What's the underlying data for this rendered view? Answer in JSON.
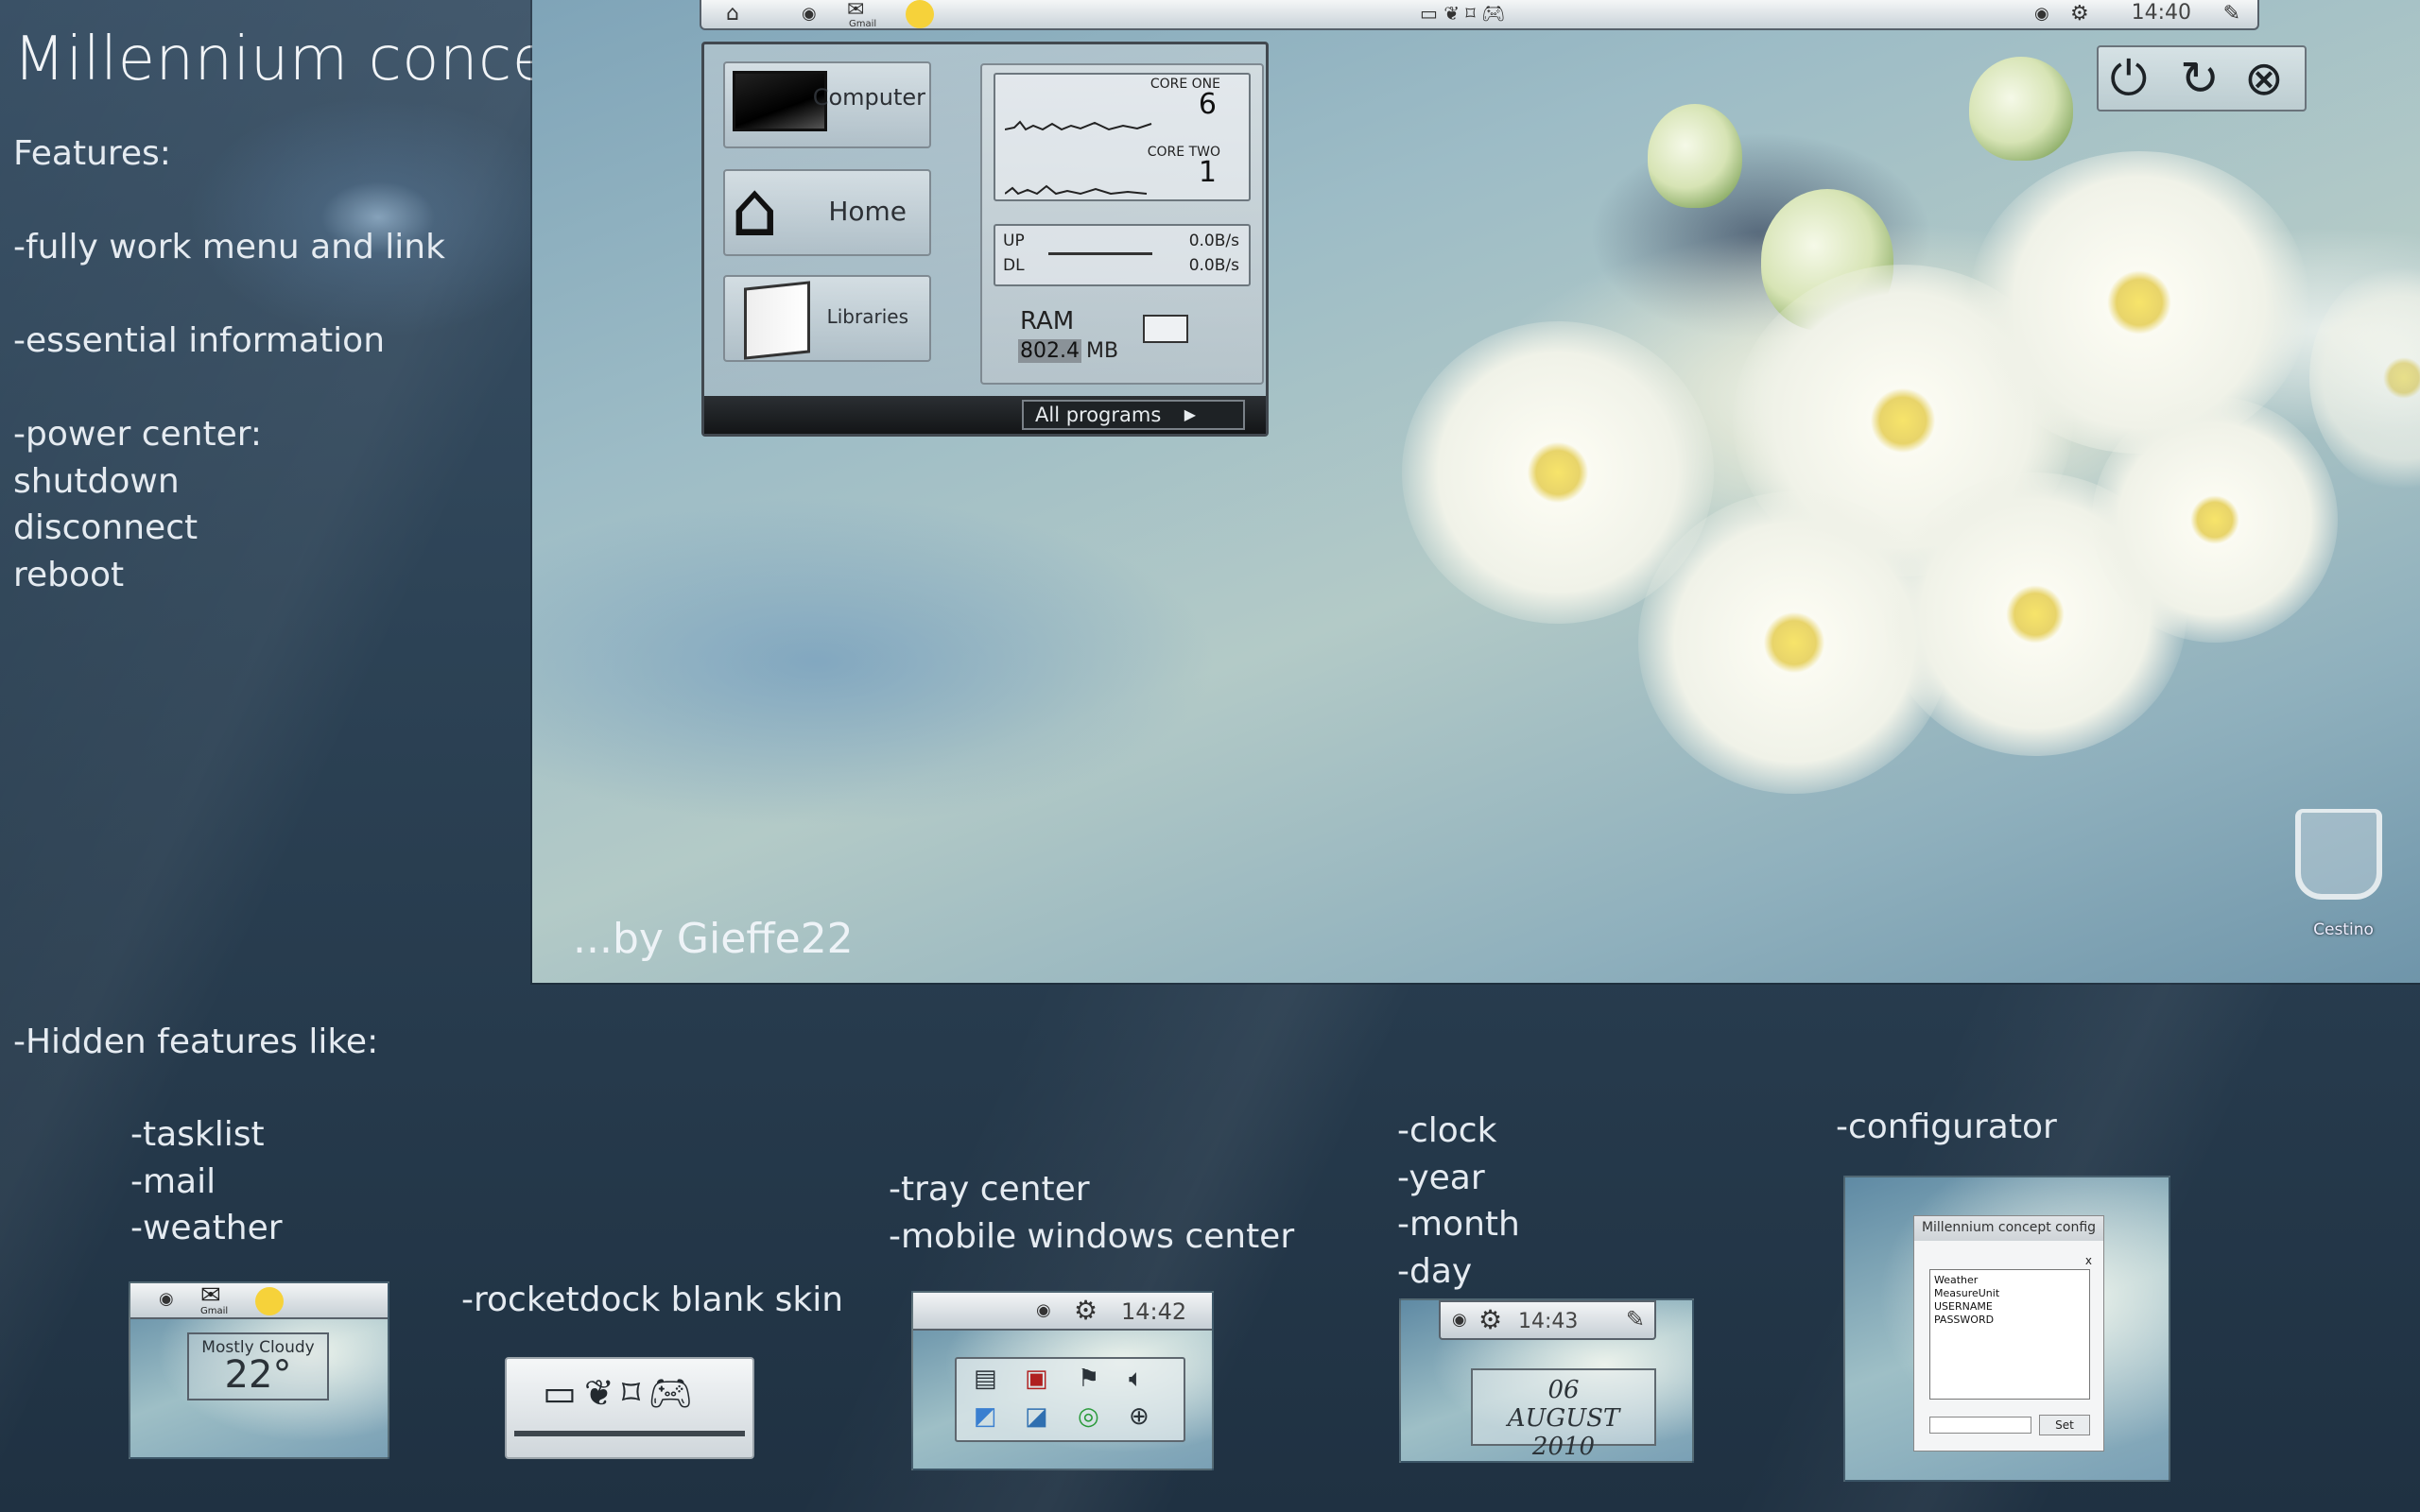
{
  "header": {
    "title": "Millennium concept",
    "features": [
      "Features:",
      "",
      "-fully work menu and link",
      "",
      "-essential information",
      "",
      "-power center:",
      "shutdown",
      "disconnect",
      "reboot"
    ]
  },
  "credit": "...by Gieffe22",
  "hidden": {
    "title": "-Hidden features like:",
    "group1": [
      "-tasklist",
      "-mail",
      "-weather"
    ],
    "group2": "-rocketdock blank skin",
    "group3": [
      "-tray center",
      "-mobile windows center"
    ],
    "group4": [
      "-clock",
      "-year",
      "-month",
      "-day"
    ],
    "group5": "-configurator"
  },
  "desktop": {
    "topbar": {
      "mail_label": "Gmail",
      "time": "14:40"
    },
    "menu": {
      "tiles": [
        "Computer",
        "Home",
        "Libraries"
      ],
      "core_one_label": "CORE ONE",
      "core_one_value": "6",
      "core_two_label": "CORE TWO",
      "core_two_value": "1",
      "up_label": "UP",
      "dl_label": "DL",
      "up_value": "0.0B/s",
      "dl_value": "0.0B/s",
      "ram_label": "RAM",
      "ram_value": "802.4",
      "ram_unit": "MB",
      "all_programs": "All programs"
    },
    "trash_label": "Cestino"
  },
  "thumbs": {
    "weather": {
      "mail_label": "Gmail",
      "condition": "Mostly Cloudy",
      "temp": "22°"
    },
    "tray": {
      "time": "14:42"
    },
    "clock": {
      "time": "14:43",
      "day": "06",
      "month_year": "AUGUST 2010"
    },
    "config": {
      "title": "Millennium concept config",
      "close": "x",
      "fields": [
        "Weather",
        "MeasureUnit",
        "USERNAME",
        "PASSWORD"
      ],
      "set_label": "Set"
    }
  }
}
